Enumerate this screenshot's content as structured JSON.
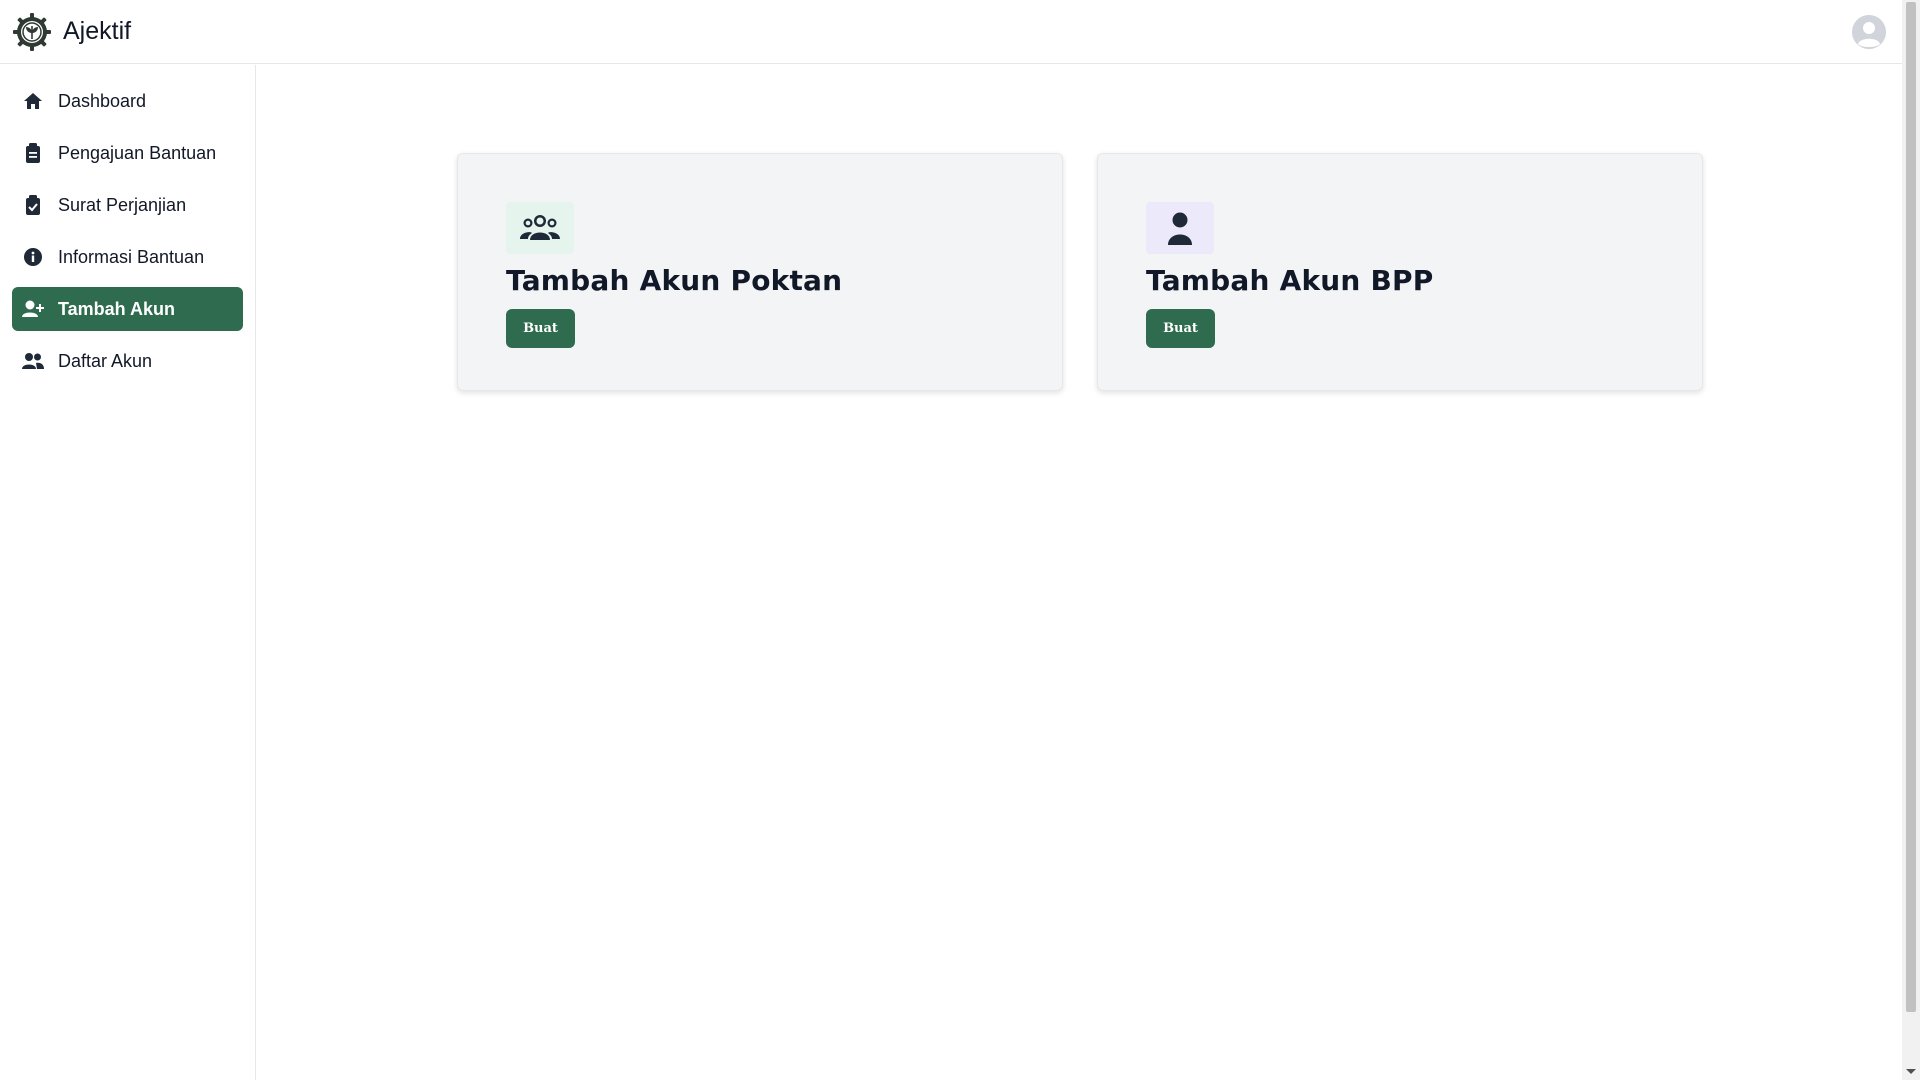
{
  "app": {
    "name": "Ajektif",
    "logo_icon": "gear-leaf-logo",
    "avatar_icon": "user-avatar-icon"
  },
  "sidebar": {
    "items": [
      {
        "label": "Dashboard",
        "icon": "home-icon",
        "active": false
      },
      {
        "label": "Pengajuan Bantuan",
        "icon": "clipboard-icon",
        "active": false
      },
      {
        "label": "Surat Perjanjian",
        "icon": "clipboard-check-icon",
        "active": false
      },
      {
        "label": "Informasi Bantuan",
        "icon": "info-icon",
        "active": false
      },
      {
        "label": "Tambah Akun",
        "icon": "user-plus-icon",
        "active": true
      },
      {
        "label": "Daftar Akun",
        "icon": "users-icon",
        "active": false
      }
    ]
  },
  "main": {
    "cards": [
      {
        "title": "Tambah Akun Poktan",
        "icon": "user-group-icon",
        "button_label": "Buat"
      },
      {
        "title": "Tambah Akun BPP",
        "icon": "user-icon",
        "button_label": "Buat"
      }
    ]
  },
  "colors": {
    "primary": "#2e6b4f",
    "card_bg": "#f3f4f6",
    "icon_bg_green": "#e5f4ec",
    "icon_bg_purple": "#ece9fb"
  }
}
